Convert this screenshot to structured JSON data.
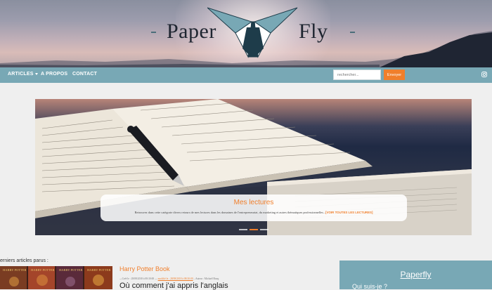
{
  "brand": {
    "left_word": "Paper",
    "right_word": "Fly",
    "logo_icon": "paper-plane-logo",
    "logo_colors": {
      "dark": "#1e3c4a",
      "teal": "#78a8b5",
      "light": "#ffffff"
    }
  },
  "nav": {
    "items": [
      {
        "label": "ARTICLES",
        "has_dropdown": true
      },
      {
        "label": "A PROPOS",
        "has_dropdown": false
      },
      {
        "label": "CONTACT",
        "has_dropdown": false
      }
    ],
    "search": {
      "placeholder": "rechercher...",
      "value": ""
    },
    "search_button": "Envoyer",
    "social_icon": "instagram-icon"
  },
  "hero": {
    "title": "Mes lectures",
    "text": "Retrouvez dans cette catégorie divers retours de mes lectures dans les domaines de l'entrepreneuriat, du marketing et autres thématiques professionnelles...",
    "link": "[VOIR TOUTES LES LECTURES]",
    "slides": 3,
    "active_slide": 2
  },
  "latest": {
    "heading": "erniers articles parus :",
    "posts": [
      {
        "title": "Harry Potter Book"
      },
      {
        "meta_prefix": "—Créé le : 28/08/2018 à 08:30:00 — ",
        "meta_category": "modifié le : 28/08/2018 à 08:30:00",
        "meta_suffix": " – Auteur : Michaël Rouq",
        "title": "Où comment j'ai appris l'anglais"
      }
    ],
    "thumbnail_alt": "Harry Potter"
  },
  "sidebar": {
    "title": "Paperfly",
    "subtitle": "Qui suis-je ?"
  },
  "colors": {
    "accent": "#f07f2c",
    "nav": "#78a8b5",
    "page_bg": "#efefef"
  }
}
